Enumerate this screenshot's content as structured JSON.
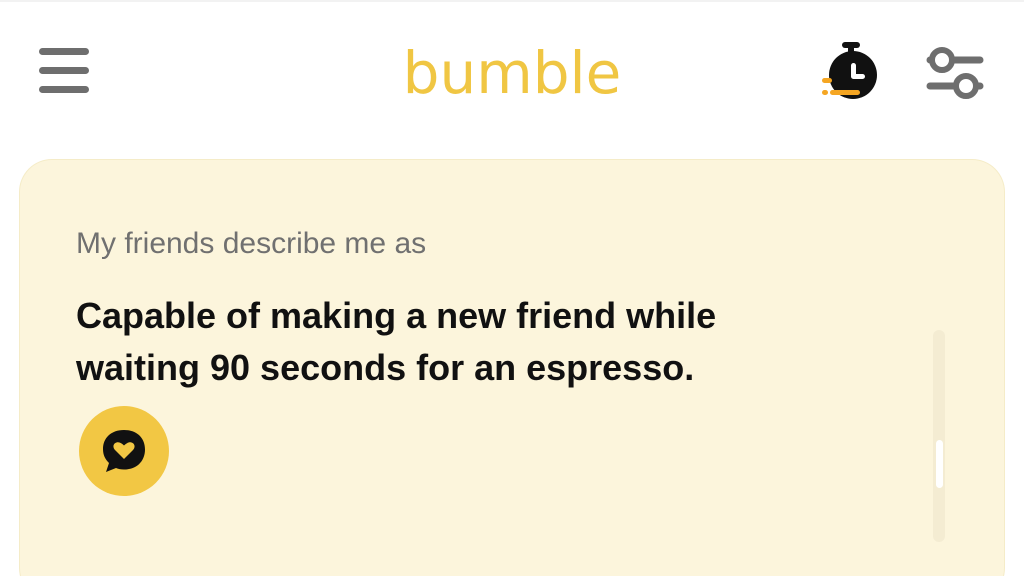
{
  "app": {
    "logo_text": "bumble",
    "brand_color": "#f0c643"
  },
  "header": {
    "menu_icon": "hamburger-menu-icon",
    "boost_icon": "stopwatch-icon",
    "filter_icon": "sliders-icon"
  },
  "card": {
    "prompt_label": "My friends describe me as",
    "answer_line1": "Capable of making a new friend while",
    "answer_line2": "waiting 90 seconds for an espresso.",
    "comment_icon": "heart-speech-bubble-icon",
    "background_color": "#fcf5dc"
  }
}
